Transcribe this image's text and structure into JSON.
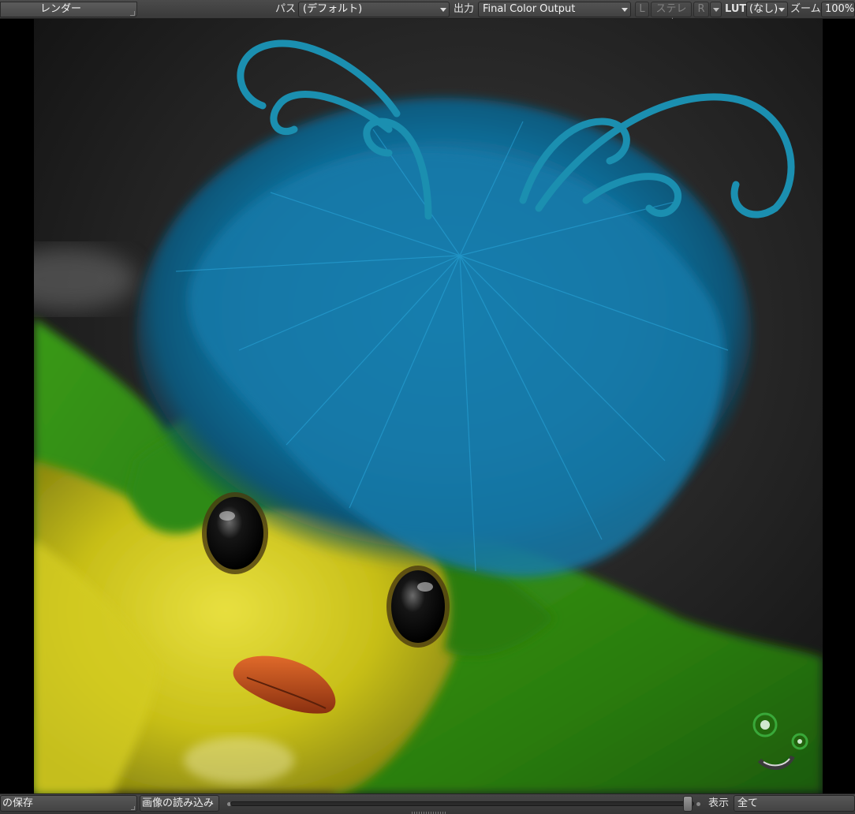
{
  "toolbar": {
    "tab_render": "レンダー",
    "pass_label": "パス",
    "pass_value": "(デフォルト)",
    "output_label": "出力",
    "output_value": "Final Color Output",
    "stereo_left": "L",
    "stereo_label": "ステレオ",
    "stereo_right": "R",
    "lut_label": "LUT",
    "lut_value": "(なし)",
    "zoom_label": "ズーム",
    "zoom_value": "100%"
  },
  "viewport": {
    "image_subject": "rendered-fluffy-creature",
    "colors": {
      "background": "#1c1c1c",
      "fur_blue": "#1479a8",
      "fur_green": "#2f8a12",
      "fur_yellow": "#d8d020",
      "beak": "#c4521c",
      "antenna": "#1b8fb0"
    },
    "logo_icon": "modo-logo-icon"
  },
  "bottombar": {
    "save_button": "の保存",
    "load_button": "画像の読み込み",
    "display_label": "表示",
    "display_value": "全て"
  }
}
